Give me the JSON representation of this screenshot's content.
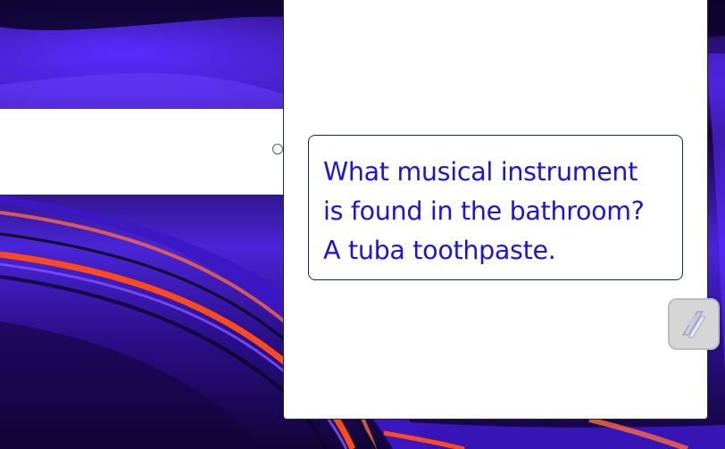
{
  "desktop": {
    "wallpaper": "abstract-purple-orange-waves"
  },
  "joke": {
    "text": "What musical instrument\nis found in the bathroom?\nA tuba toothpaste."
  },
  "fab": {
    "icon": "slash-logo-icon"
  },
  "colors": {
    "text_blue": "#1a13e6",
    "panel_border": "#1f2d3a",
    "wallpaper_purple": "#4a25d8",
    "wallpaper_orange": "#ff4a1c"
  }
}
